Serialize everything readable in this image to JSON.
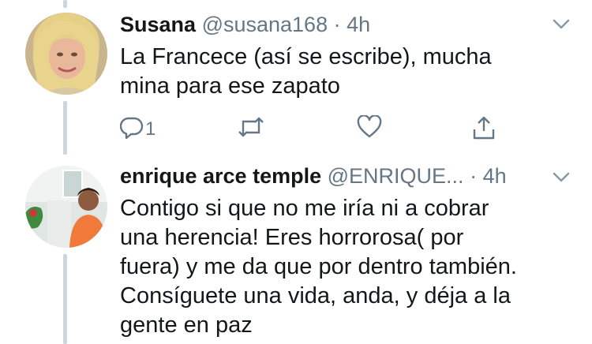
{
  "tweets": [
    {
      "display_name": "Susana",
      "handle": "@susana168",
      "separator": "·",
      "time": "4h",
      "text": "La Francece (así se escribe), mucha\nmina para ese zapato",
      "reply_count": "1",
      "retweet_count": "",
      "like_count": ""
    },
    {
      "display_name": "enrique arce temple",
      "handle": "@ENRIQUE...",
      "separator": "·",
      "time": "4h",
      "text": "Contigo si que no me iría ni a cobrar\nuna herencia! Eres horrorosa( por\nfuera) y me da que por dentro también.\nConsíguete una vida, anda, y déja a la\ngente en paz"
    }
  ],
  "icons": [
    "reply-icon",
    "retweet-icon",
    "like-icon",
    "share-icon",
    "chevron-down-icon"
  ],
  "colors": {
    "text": "#14171a",
    "secondary": "#657786",
    "thread_line": "#ccd6dd"
  }
}
